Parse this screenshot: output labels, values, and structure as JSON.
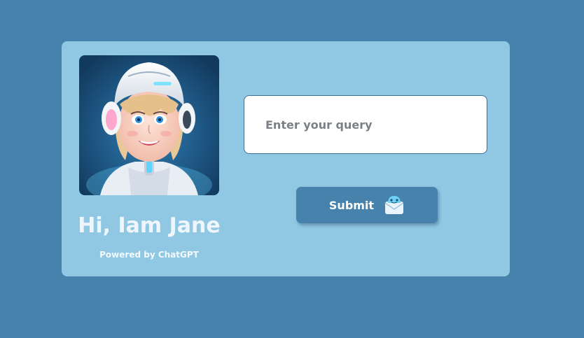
{
  "profile": {
    "greeting": "Hi, Iam Jane",
    "powered_by": "Powered by ChatGPT",
    "avatar_icon": "robot-girl-avatar-icon"
  },
  "query": {
    "placeholder": "Enter your query",
    "value": ""
  },
  "submit": {
    "label": "Submit",
    "icon": "mail-icon"
  },
  "colors": {
    "page_background": "#4682ab",
    "card_background": "#90c8e4",
    "button_background": "#4682ab"
  }
}
